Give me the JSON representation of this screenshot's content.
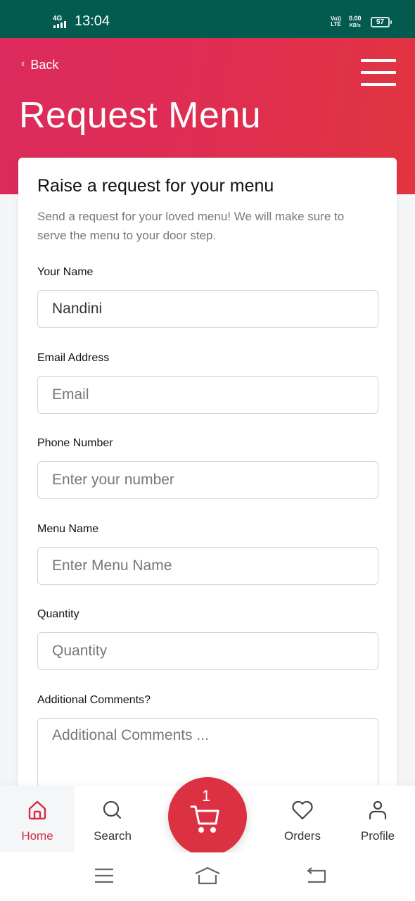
{
  "status_bar": {
    "network": "4G",
    "time": "13:04",
    "volte_top": "Vo))",
    "volte_bottom": "LTE",
    "speed_value": "0.00",
    "speed_unit": "KB/s",
    "battery": "57"
  },
  "header": {
    "back_label": "Back",
    "title": "Request Menu",
    "menu_icon": "hamburger-icon",
    "gradient_colors": [
      "#dc2a5e",
      "#e13540"
    ]
  },
  "form": {
    "title": "Raise a request for your menu",
    "description": "Send a request for your loved menu! We will make sure to serve the menu to your door step.",
    "fields": [
      {
        "label": "Your Name",
        "value": "Nandini",
        "placeholder": ""
      },
      {
        "label": "Email Address",
        "value": "",
        "placeholder": "Email"
      },
      {
        "label": "Phone Number",
        "value": "",
        "placeholder": "Enter your number"
      },
      {
        "label": "Menu Name",
        "value": "",
        "placeholder": "Enter Menu Name"
      },
      {
        "label": "Quantity",
        "value": "",
        "placeholder": "Quantity"
      },
      {
        "label": "Additional Comments?",
        "value": "",
        "placeholder": "Additional Comments ..."
      }
    ]
  },
  "bottom_nav": {
    "items": [
      {
        "label": "Home",
        "icon": "home-icon",
        "active": true
      },
      {
        "label": "Search",
        "icon": "search-icon",
        "active": false
      },
      {
        "label": "Orders",
        "icon": "heart-icon",
        "active": false
      },
      {
        "label": "Profile",
        "icon": "user-icon",
        "active": false
      }
    ],
    "cart": {
      "icon": "cart-icon",
      "count": "1"
    },
    "accent_color": "#dc3142"
  },
  "system_nav": {
    "buttons": [
      "recent-apps-icon",
      "home-icon",
      "back-icon"
    ]
  }
}
